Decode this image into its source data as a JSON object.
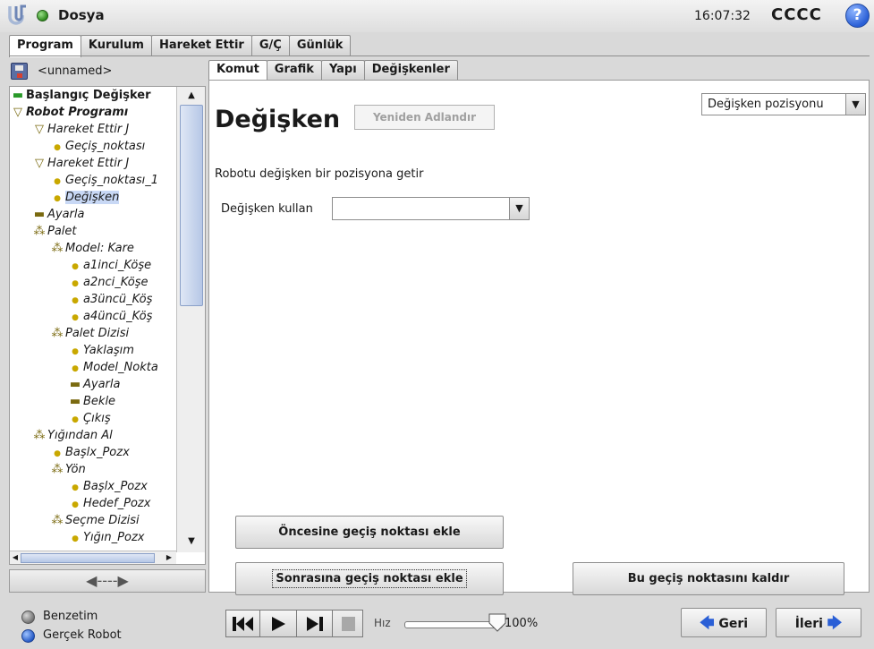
{
  "header": {
    "app_name": "Dosya",
    "time": "16:07:32",
    "robot_name": "CCCC",
    "help": "?"
  },
  "top_tabs": [
    "Program",
    "Kurulum",
    "Hareket Ettir",
    "G/Ç",
    "Günlük"
  ],
  "active_top_tab": "Program",
  "file": {
    "name": "<unnamed>"
  },
  "tree": [
    {
      "label": "Başlangıç Değişker",
      "icon": "init-variables-icon",
      "indent": 0,
      "bold": true
    },
    {
      "label": "Robot Programı",
      "icon": "program-triangle-icon",
      "indent": 0,
      "robot": true
    },
    {
      "label": "Hareket Ettir J",
      "icon": "move-triangle-icon",
      "indent": 1
    },
    {
      "label": "Geçiş_noktası",
      "icon": "waypoint-icon",
      "indent": 2
    },
    {
      "label": "Hareket Ettir J",
      "icon": "move-triangle-icon",
      "indent": 1
    },
    {
      "label": "Geçiş_noktası_1",
      "icon": "waypoint-icon",
      "indent": 2
    },
    {
      "label": "Değişken",
      "icon": "waypoint-icon",
      "indent": 2,
      "selected": true
    },
    {
      "label": "Ayarla",
      "icon": "set-icon",
      "indent": 1
    },
    {
      "label": "Palet",
      "icon": "pallet-icon",
      "indent": 1
    },
    {
      "label": "Model: Kare",
      "icon": "pallet-icon",
      "indent": 2
    },
    {
      "label": "a1inci_Köşe",
      "icon": "waypoint-icon",
      "indent": 3
    },
    {
      "label": "a2nci_Köşe",
      "icon": "waypoint-icon",
      "indent": 3
    },
    {
      "label": "a3üncü_Köş",
      "icon": "waypoint-icon",
      "indent": 3
    },
    {
      "label": "a4üncü_Köş",
      "icon": "waypoint-icon",
      "indent": 3
    },
    {
      "label": "Palet Dizisi",
      "icon": "pallet-icon",
      "indent": 2
    },
    {
      "label": "Yaklaşım",
      "icon": "waypoint-icon",
      "indent": 3
    },
    {
      "label": "Model_Nokta",
      "icon": "waypoint-icon",
      "indent": 3
    },
    {
      "label": "Ayarla",
      "icon": "set-icon",
      "indent": 3
    },
    {
      "label": "Bekle",
      "icon": "set-icon",
      "indent": 3
    },
    {
      "label": "Çıkış",
      "icon": "waypoint-icon",
      "indent": 3
    },
    {
      "label": "Yığından Al",
      "icon": "pallet-icon",
      "indent": 1
    },
    {
      "label": "Başlx_Pozx",
      "icon": "waypoint-icon",
      "indent": 2
    },
    {
      "label": "Yön",
      "icon": "pallet-icon",
      "indent": 2
    },
    {
      "label": "Başlx_Pozx",
      "icon": "waypoint-icon",
      "indent": 3
    },
    {
      "label": "Hedef_Pozx",
      "icon": "waypoint-icon",
      "indent": 3
    },
    {
      "label": "Seçme Dizisi",
      "icon": "pallet-icon",
      "indent": 2
    },
    {
      "label": "Yığın_Pozx",
      "icon": "waypoint-icon",
      "indent": 3
    }
  ],
  "sub_tabs": [
    "Komut",
    "Grafik",
    "Yapı",
    "Değişkenler"
  ],
  "active_sub_tab": "Komut",
  "command": {
    "title": "Değişken",
    "rename_label": "Yeniden Adlandır",
    "waypoint_type": "Değişken pozisyonu",
    "description": "Robotu değişken bir pozisyona getir",
    "use_variable_label": "Değişken kullan",
    "use_variable_value": "",
    "add_before_label": "Öncesine geçiş noktası ekle",
    "add_after_label": "Sonrasına geçiş noktası ekle",
    "remove_label": "Bu geçiş noktasını kaldır"
  },
  "footer": {
    "simulation_label": "Benzetim",
    "real_robot_label": "Gerçek Robot",
    "speed_label": "Hız",
    "speed_value": "100%",
    "speed_fraction": 1.0,
    "back_label": "Geri",
    "next_label": "İleri"
  },
  "colors": {
    "selection": "#c8d8f5",
    "accent_blue": "#2a5fd6",
    "status_green": "#2f8a1e"
  }
}
